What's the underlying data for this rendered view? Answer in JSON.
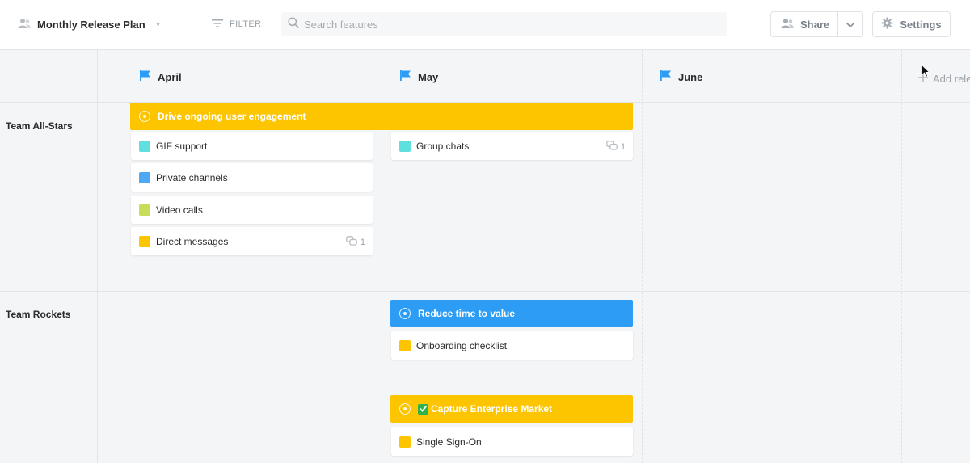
{
  "header": {
    "plan_title": "Monthly Release Plan",
    "filter_label": "FILTER",
    "search_placeholder": "Search features",
    "share_label": "Share",
    "settings_label": "Settings"
  },
  "months": [
    {
      "label": "April"
    },
    {
      "label": "May"
    },
    {
      "label": "June"
    }
  ],
  "add_release_label": "Add rele",
  "teams": [
    {
      "label": "Team All-Stars"
    },
    {
      "label": "Team Rockets"
    }
  ],
  "objectives": [
    {
      "label": "Drive ongoing user engagement",
      "color": "#fdc400"
    },
    {
      "label": "Reduce time to value",
      "color": "#2c9cf4"
    },
    {
      "label": "Capture Enterprise Market",
      "color": "#fdc400"
    }
  ],
  "features": [
    {
      "label": "GIF support",
      "color": "#5fdfe0",
      "comments": ""
    },
    {
      "label": "Private channels",
      "color": "#4ea8f5",
      "comments": ""
    },
    {
      "label": "Video calls",
      "color": "#c8dd5a",
      "comments": ""
    },
    {
      "label": "Direct messages",
      "color": "#fdc400",
      "comments": "1"
    },
    {
      "label": "Group chats",
      "color": "#5fdfe0",
      "comments": "1"
    },
    {
      "label": "Onboarding checklist",
      "color": "#fdc400",
      "comments": ""
    },
    {
      "label": "Single Sign-On",
      "color": "#fdc400",
      "comments": ""
    }
  ],
  "colors": {
    "accent_yellow": "#fdc400",
    "accent_blue": "#2c9cf4",
    "flag_blue": "#2c9cf4"
  }
}
